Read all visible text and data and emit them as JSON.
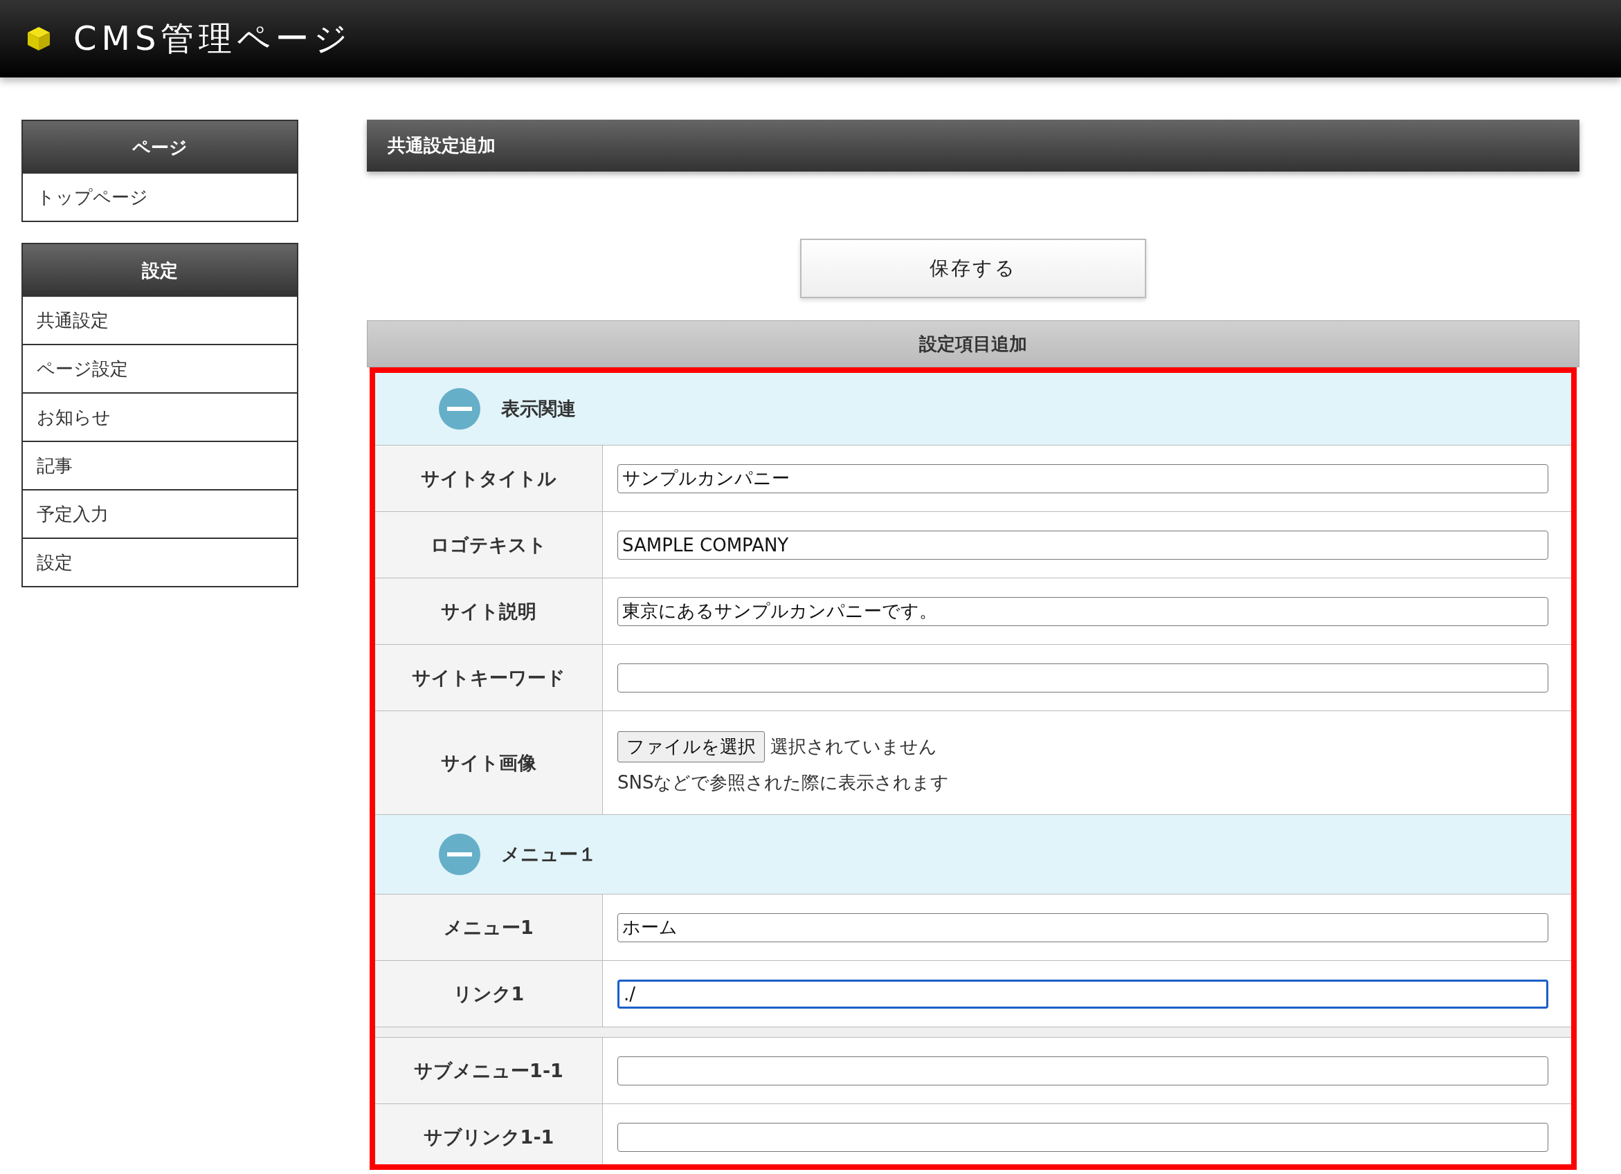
{
  "header": {
    "title": "CMS管理ページ"
  },
  "sidebar": [
    {
      "title": "ページ",
      "items": [
        {
          "label": "トップページ"
        }
      ]
    },
    {
      "title": "設定",
      "items": [
        {
          "label": "共通設定"
        },
        {
          "label": "ページ設定"
        },
        {
          "label": "お知らせ"
        },
        {
          "label": "記事"
        },
        {
          "label": "予定入力"
        },
        {
          "label": "設定"
        }
      ]
    }
  ],
  "main": {
    "title": "共通設定追加",
    "save_button": "保存する",
    "panel_title": "設定項目追加",
    "sections": [
      {
        "title": "表示関連",
        "expanded": true,
        "rows": [
          {
            "kind": "text",
            "label": "サイトタイトル",
            "value": "サンプルカンパニー",
            "focused": false
          },
          {
            "kind": "text",
            "label": "ロゴテキスト",
            "value": "SAMPLE COMPANY",
            "focused": false
          },
          {
            "kind": "text",
            "label": "サイト説明",
            "value": "東京にあるサンプルカンパニーです。",
            "focused": false
          },
          {
            "kind": "text",
            "label": "サイトキーワード",
            "value": "",
            "focused": false
          },
          {
            "kind": "file",
            "label": "サイト画像",
            "button": "ファイルを選択",
            "status": "選択されていません",
            "note": "SNSなどで参照された際に表示されます"
          }
        ]
      },
      {
        "title": "メニュー１",
        "expanded": true,
        "rows": [
          {
            "kind": "text",
            "label": "メニュー1",
            "value": "ホーム",
            "focused": false
          },
          {
            "kind": "text",
            "label": "リンク1",
            "value": "./",
            "focused": true
          },
          {
            "kind": "separator"
          },
          {
            "kind": "text",
            "label": "サブメニュー1-1",
            "value": "",
            "focused": false
          },
          {
            "kind": "text",
            "label": "サブリンク1-1",
            "value": "",
            "focused": false
          }
        ]
      }
    ]
  }
}
